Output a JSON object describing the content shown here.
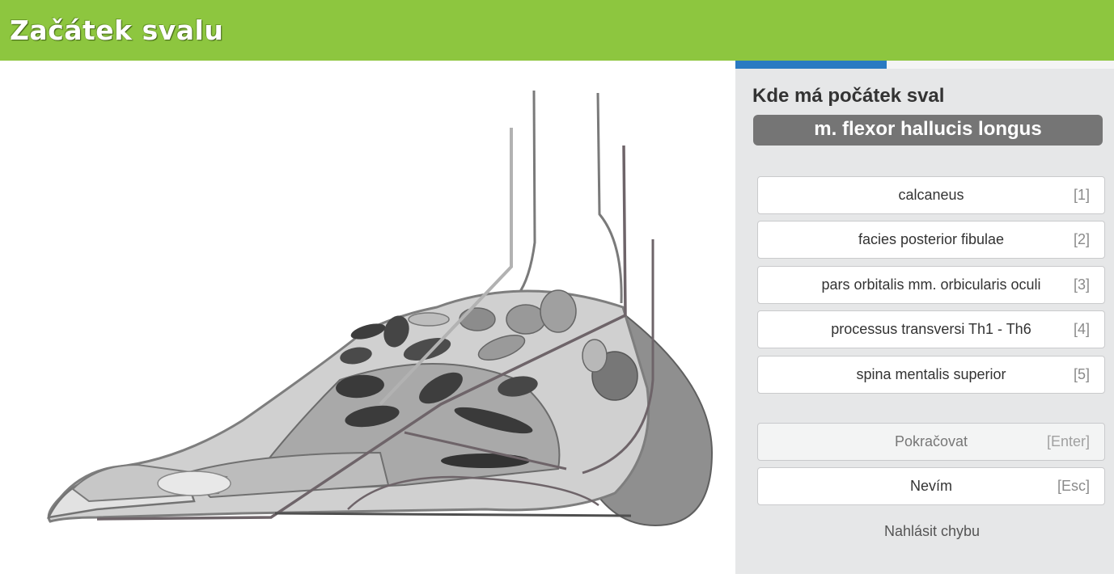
{
  "app": {
    "title": "Začátek svalu"
  },
  "progress": {
    "fraction": 0.4
  },
  "question": {
    "prompt": "Kde má počátek sval",
    "term": "m. flexor hallucis longus"
  },
  "answers": [
    {
      "label": "calcaneus",
      "key": "[1]"
    },
    {
      "label": "facies posterior fibulae",
      "key": "[2]"
    },
    {
      "label": "pars orbitalis mm. orbicularis oculi",
      "key": "[3]"
    },
    {
      "label": "processus transversi Th1 - Th6",
      "key": "[4]"
    },
    {
      "label": "spina mentalis superior",
      "key": "[5]"
    }
  ],
  "actions": {
    "continue_label": "Pokračovat",
    "continue_key": "[Enter]",
    "dontknow_label": "Nevím",
    "dontknow_key": "[Esc]",
    "report_label": "Nahlásit chybu"
  },
  "colors": {
    "header": "#8dc63f",
    "progress": "#2a7ac2",
    "panel": "#e6e7e8",
    "term_bg": "#757575"
  },
  "illustration": {
    "subject": "foot-anatomy-lateral-view"
  }
}
